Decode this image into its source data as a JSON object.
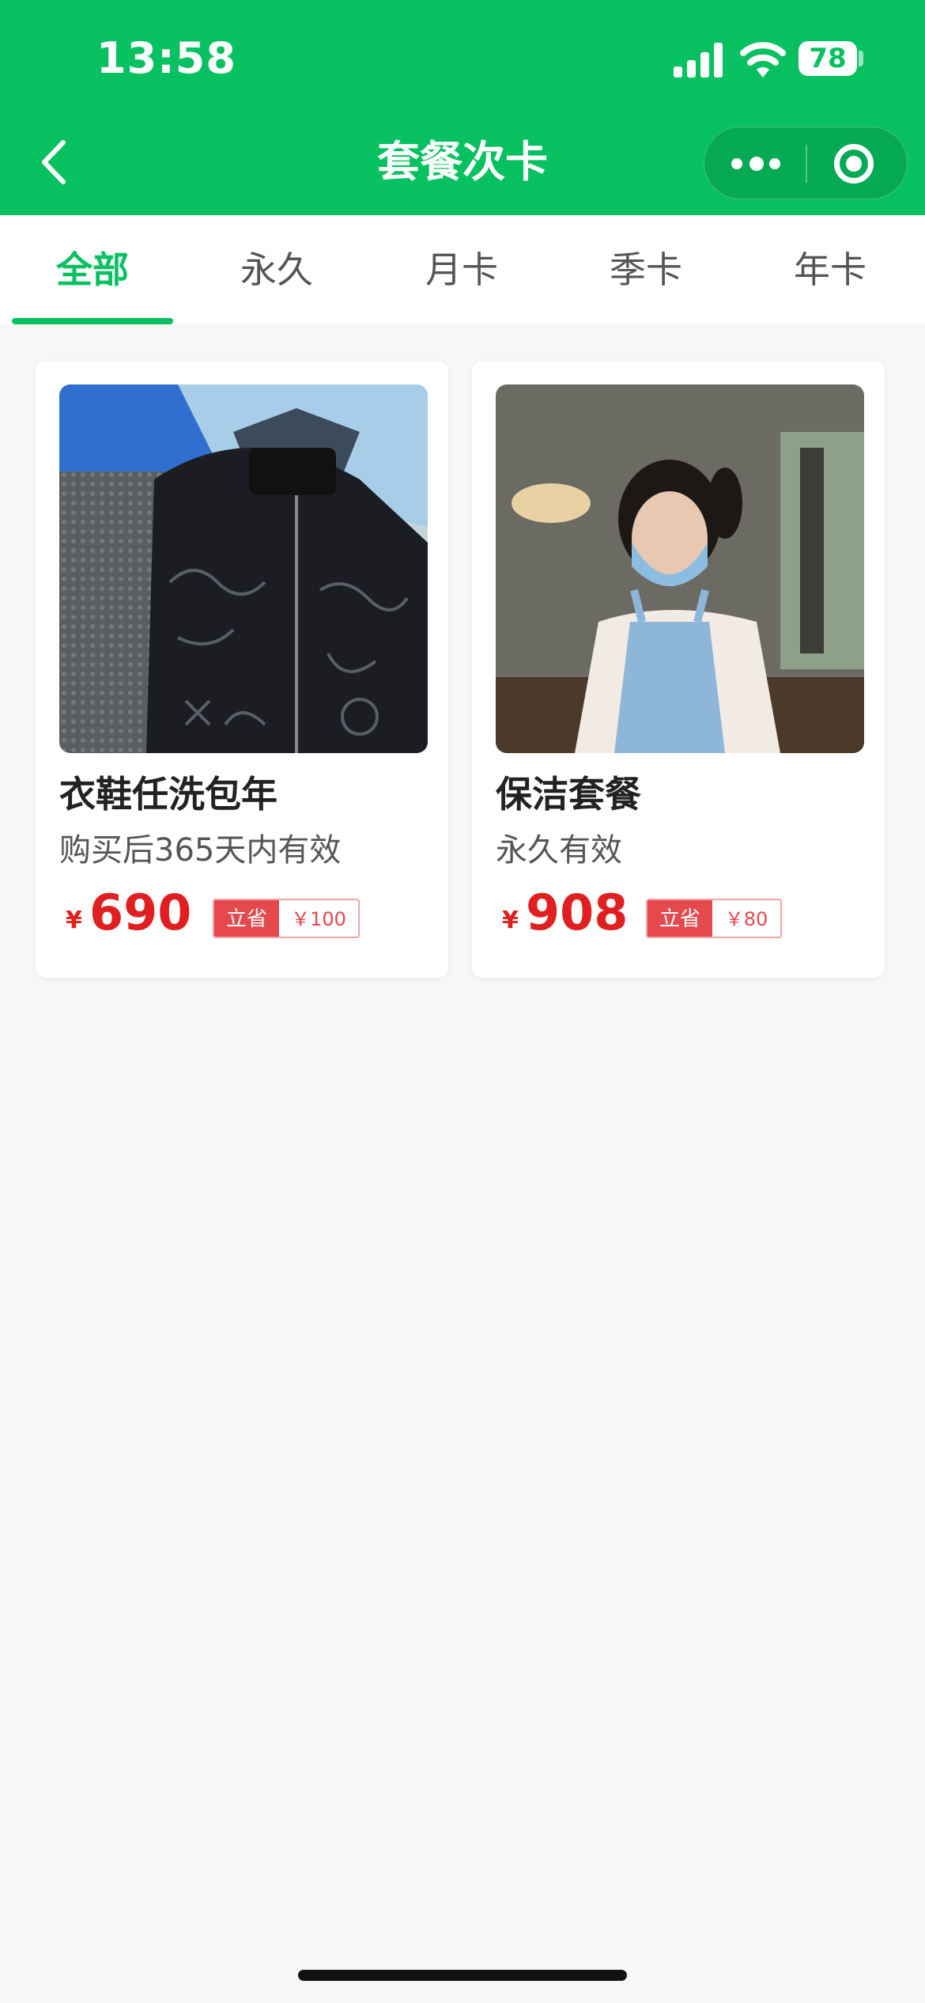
{
  "status_bar": {
    "time": "13:58",
    "battery": "78"
  },
  "nav": {
    "title": "套餐次卡",
    "back_icon": "chevron-left-icon",
    "more_icon": "more-dots-icon",
    "close_icon": "target-close-icon"
  },
  "colors": {
    "brand": "#07c160",
    "price": "#e02020",
    "badge": "#e5484d",
    "background": "#f7f7f7"
  },
  "tabs": [
    {
      "label": "全部",
      "active": true
    },
    {
      "label": "永久",
      "active": false
    },
    {
      "label": "月卡",
      "active": false
    },
    {
      "label": "季卡",
      "active": false
    },
    {
      "label": "年卡",
      "active": false
    }
  ],
  "packages": [
    {
      "title": "衣鞋任洗包年",
      "subtitle": "购买后365天内有效",
      "currency": "¥",
      "price": "690",
      "save_label": "立省",
      "save_amount": "￥100",
      "image": "clothing-jackets-photo"
    },
    {
      "title": "保洁套餐",
      "subtitle": "永久有效",
      "currency": "¥",
      "price": "908",
      "save_label": "立省",
      "save_amount": "￥80",
      "image": "cleaning-worker-photo"
    }
  ]
}
